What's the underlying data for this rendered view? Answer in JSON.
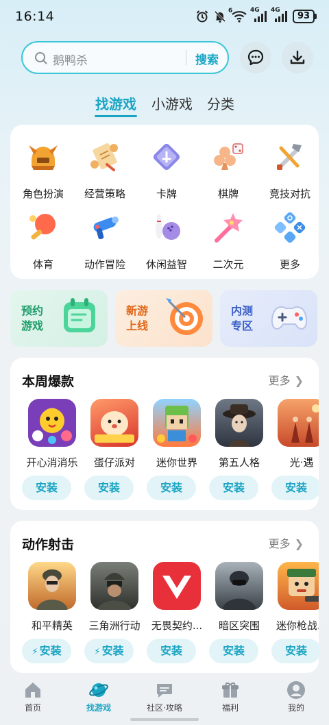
{
  "status": {
    "time": "16:14",
    "battery": "93",
    "network_1": "4G",
    "network_2": "4G",
    "wifi_badge": "6"
  },
  "search": {
    "placeholder": "鹅鸭杀",
    "button": "搜索"
  },
  "tabs": [
    {
      "label": "找游戏",
      "active": true
    },
    {
      "label": "小游戏",
      "active": false
    },
    {
      "label": "分类",
      "active": false
    }
  ],
  "categories": [
    {
      "label": "角色扮演",
      "icon": "helmet-icon"
    },
    {
      "label": "经营策略",
      "icon": "scroll-icon"
    },
    {
      "label": "卡牌",
      "icon": "card-icon"
    },
    {
      "label": "棋牌",
      "icon": "club-dice-icon"
    },
    {
      "label": "竞技对抗",
      "icon": "crossed-weapons-icon"
    },
    {
      "label": "体育",
      "icon": "ping-pong-icon"
    },
    {
      "label": "动作冒险",
      "icon": "blaster-icon"
    },
    {
      "label": "休闲益智",
      "icon": "bowling-icon"
    },
    {
      "label": "二次元",
      "icon": "magic-wand-icon"
    },
    {
      "label": "更多",
      "icon": "more-grid-icon"
    }
  ],
  "promos": [
    {
      "label": "预约游戏",
      "line1": "预约",
      "line2": "游戏",
      "color": "#1e9d6a"
    },
    {
      "label": "新游上线",
      "line1": "新游",
      "line2": "上线",
      "color": "#e0691b"
    },
    {
      "label": "内测专区",
      "line1": "内测",
      "line2": "专区",
      "color": "#3a5fc8"
    }
  ],
  "weekly": {
    "title": "本周爆款",
    "more": "更多",
    "games": [
      {
        "name": "开心消消乐",
        "install": "安装",
        "fast": false
      },
      {
        "name": "蛋仔派对",
        "install": "安装",
        "fast": false
      },
      {
        "name": "迷你世界",
        "install": "安装",
        "fast": false
      },
      {
        "name": "第五人格",
        "install": "安装",
        "fast": false
      },
      {
        "name": "光·遇",
        "install": "安装",
        "fast": false
      }
    ]
  },
  "action": {
    "title": "动作射击",
    "more": "更多",
    "games": [
      {
        "name": "和平精英",
        "install": "安装",
        "fast": true
      },
      {
        "name": "三角洲行动",
        "install": "安装",
        "fast": true
      },
      {
        "name": "无畏契约...",
        "install": "安装",
        "fast": false
      },
      {
        "name": "暗区突围",
        "install": "安装",
        "fast": false
      },
      {
        "name": "迷你枪战...",
        "install": "安装",
        "fast": false
      }
    ]
  },
  "nav": [
    {
      "label": "首页",
      "icon": "home-icon",
      "active": false
    },
    {
      "label": "找游戏",
      "icon": "planet-icon",
      "active": true
    },
    {
      "label": "社区·攻略",
      "icon": "chat-bubble-icon",
      "active": false
    },
    {
      "label": "福利",
      "icon": "gift-icon",
      "active": false
    },
    {
      "label": "我的",
      "icon": "profile-icon",
      "active": false
    }
  ],
  "colors": {
    "accent": "#1aa4c3",
    "search_border": "#3cc6d8",
    "install_bg": "#e2f4f8"
  }
}
